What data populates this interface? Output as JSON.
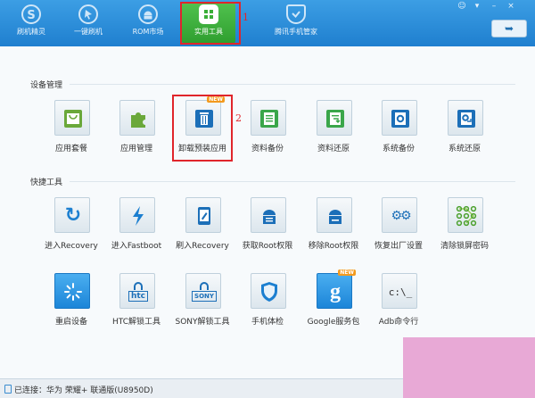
{
  "nav": {
    "tabs": [
      {
        "label": "刷机精灵",
        "icon": "s-logo-icon"
      },
      {
        "label": "一键刷机",
        "icon": "arrow-cursor-icon"
      },
      {
        "label": "ROM市场",
        "icon": "android-icon"
      },
      {
        "label": "实用工具",
        "icon": "grid-apps-icon",
        "active": true
      },
      {
        "label": "腾讯手机管家",
        "icon": "shield-check-icon"
      }
    ],
    "annotation_1": "1",
    "back_icon": "return-arrow-icon",
    "window_controls": [
      "☺",
      "▾",
      "–",
      "×"
    ]
  },
  "device_management": {
    "title": "设备管理",
    "items": [
      {
        "label": "应用套餐",
        "icon": "shopping-bag-icon",
        "color": "#6aa83a"
      },
      {
        "label": "应用管理",
        "icon": "puzzle-piece-icon",
        "color": "#6aa83a"
      },
      {
        "label": "卸载预装应用",
        "icon": "trash-can-icon",
        "color": "#1c6fb8",
        "badge": "NEW"
      },
      {
        "label": "资料备份",
        "icon": "document-backup-icon",
        "color": "#3aa64a"
      },
      {
        "label": "资料还原",
        "icon": "document-restore-icon",
        "color": "#3aa64a"
      },
      {
        "label": "系统备份",
        "icon": "system-gear-backup-icon",
        "color": "#1c6fb8"
      },
      {
        "label": "系统还原",
        "icon": "system-gear-restore-icon",
        "color": "#1c6fb8"
      }
    ],
    "annotation_2": "2"
  },
  "quick_tools": {
    "title": "快捷工具",
    "row1": [
      {
        "label": "进入Recovery",
        "icon": "refresh-icon"
      },
      {
        "label": "进入Fastboot",
        "icon": "lightning-icon"
      },
      {
        "label": "刷入Recovery",
        "icon": "tablet-edit-icon"
      },
      {
        "label": "获取Root权限",
        "icon": "android-root-icon"
      },
      {
        "label": "移除Root权限",
        "icon": "android-unroot-icon"
      },
      {
        "label": "恢复出厂设置",
        "icon": "gears-icon"
      },
      {
        "label": "清除锁屏密码",
        "icon": "pattern-lock-icon"
      }
    ],
    "row2": [
      {
        "label": "重启设备",
        "icon": "reboot-spinner-icon"
      },
      {
        "label": "HTC解锁工具",
        "icon": "htc-lock-icon",
        "brand": "htc"
      },
      {
        "label": "SONY解锁工具",
        "icon": "sony-lock-icon",
        "brand": "SONY"
      },
      {
        "label": "手机体检",
        "icon": "shield-icon"
      },
      {
        "label": "Google服务包",
        "icon": "google-g-icon",
        "badge": "NEW"
      },
      {
        "label": "Adb命令行",
        "icon": "terminal-icon",
        "glyph": "c:\\_"
      }
    ]
  },
  "status": {
    "text": "已连接：华为 荣耀+ 联通版(U8950D)"
  }
}
